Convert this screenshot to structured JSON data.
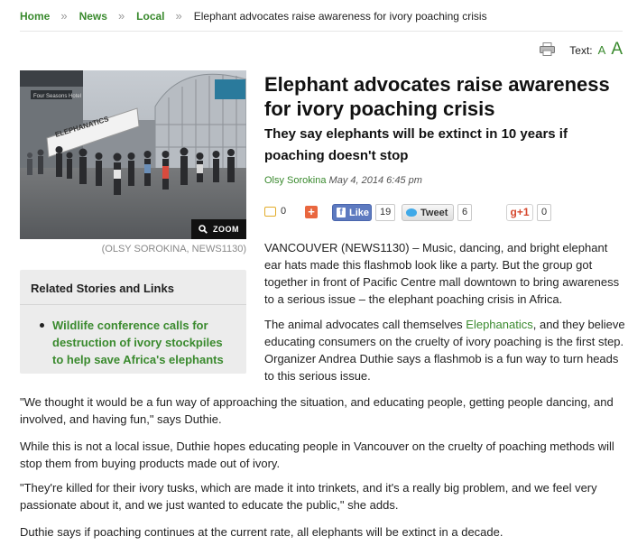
{
  "breadcrumb": {
    "items": [
      "Home",
      "News",
      "Local"
    ],
    "separator": "»",
    "current": "Elephant advocates raise awareness for ivory poaching crisis"
  },
  "text_tools": {
    "label": "Text:",
    "small": "A",
    "large": "A"
  },
  "photo": {
    "zoom_label": "ZOOM",
    "credit": "(OLSY SOROKINA, NEWS1130)",
    "banner_text": "ELEPHANATICS",
    "building_sign": "Four Seasons Hotel"
  },
  "related": {
    "title": "Related Stories and Links",
    "links": [
      "Wildlife conference calls for destruction of ivory stockpiles to help save Africa's elephants"
    ]
  },
  "article": {
    "headline": "Elephant advocates raise awareness for ivory poaching crisis",
    "subhead": "They say elephants will be extinct in 10 years if poaching doesn't stop",
    "author": "Olsy Sorokina",
    "date": "May 4, 2014 6:45 pm",
    "p1": "VANCOUVER (NEWS1130) – Music, dancing, and bright elephant ear hats made this flashmob look like a party. But the group got together in front of Pacific Centre mall downtown to bring awareness to a serious issue – the elephant poaching crisis in Africa.",
    "p2_before": "The animal advocates call themselves ",
    "p2_link": "Elephanatics",
    "p2_after": ", and they believe educating consumers on the cruelty of ivory poaching is the first step. Organizer Andrea Duthie says a flashmob is a fun way to turn heads to this serious issue.",
    "p3": "\"We thought it would be a fun way of approaching the situation, and educating people, getting people dancing, and involved, and having fun,\" says Duthie.",
    "p4": "While this is not a local issue, Duthie hopes educating people in Vancouver on the cruelty of poaching methods will stop them from buying products made out of ivory.",
    "p5": "\"They're killed for their ivory tusks, which are made it into trinkets, and it's a really big problem, and we feel very passionate about it, and we just wanted to educate the public,\" she adds.",
    "p6": "Duthie says if poaching continues at the current rate, all elephants will be extinct in a decade."
  },
  "social": {
    "comments": "0",
    "fb_label": "Like",
    "fb_icon": "f",
    "fb_count": "19",
    "tweet_label": "Tweet",
    "tweet_count": "6",
    "gplus_label": "g+1",
    "gplus_count": "0",
    "share_glyph": "+"
  },
  "colors": {
    "link_green": "#3a8a2e",
    "fb_blue": "#5d7ac0",
    "share_orange": "#e9673f"
  }
}
